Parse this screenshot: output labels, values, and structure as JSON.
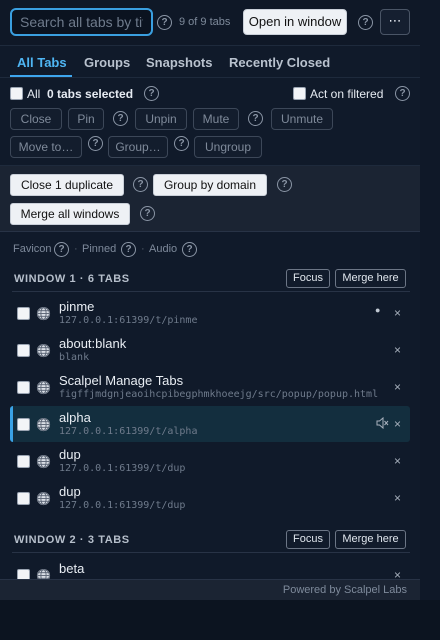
{
  "topbar": {
    "search_placeholder": "Search all tabs by title or URL",
    "count": "9 of 9 tabs",
    "open_window": "Open in window",
    "more": "⋯"
  },
  "help_glyph": "?",
  "tabs": [
    "All Tabs",
    "Groups",
    "Snapshots",
    "Recently Closed"
  ],
  "selection": {
    "all_label": "All",
    "selected": "0 tabs selected",
    "act_filtered": "Act on filtered"
  },
  "bulk": [
    "Close",
    "Pin",
    "Unpin",
    "Mute",
    "Unmute",
    "Move to…",
    "Group…",
    "Ungroup"
  ],
  "quick": {
    "close_dup": "Close 1 duplicate",
    "group_domain": "Group by domain",
    "merge_all": "Merge all windows"
  },
  "columns": {
    "favicon": "Favicon",
    "pinned": "Pinned",
    "audio": "Audio",
    "sep": "·"
  },
  "windows": [
    {
      "heading": "WINDOW 1 · 6 TABS",
      "focus": "Focus",
      "merge": "Merge here",
      "tabs": [
        {
          "title": "pinme",
          "url": "127.0.0.1:61399/t/pinme",
          "pinned": true
        },
        {
          "title": "about:blank",
          "url": "blank"
        },
        {
          "title": "Scalpel Manage Tabs",
          "url": "figffjmdgnjeaoihcpibegphmkhoeejg/src/popup/popup.html"
        },
        {
          "title": "alpha",
          "url": "127.0.0.1:61399/t/alpha",
          "audible": true
        },
        {
          "title": "dup",
          "url": "127.0.0.1:61399/t/dup"
        },
        {
          "title": "dup",
          "url": "127.0.0.1:61399/t/dup"
        }
      ]
    },
    {
      "heading": "WINDOW 2 · 3 TABS",
      "focus": "Focus",
      "merge": "Merge here",
      "tabs": [
        {
          "title": "beta",
          "url": ""
        }
      ]
    }
  ],
  "close_glyph": "×",
  "pin_glyph": "●",
  "footer": "Powered by Scalpel Labs",
  "colors": {
    "accent": "#3ea6ee",
    "active_row": "#132e3e",
    "panel": "#101a2a"
  }
}
